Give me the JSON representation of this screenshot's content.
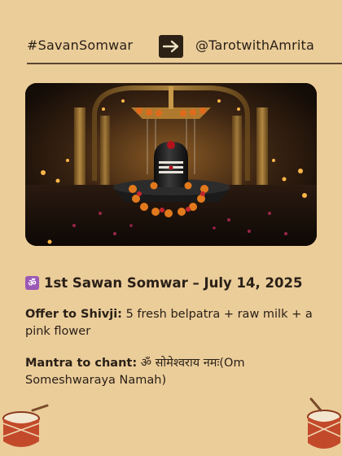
{
  "header": {
    "hashtag": "#SavanSomwar",
    "handle": "@TarotwithAmrita",
    "arrow_icon": "right-arrow-icon"
  },
  "photo": {
    "description_icon": "shivling-icon"
  },
  "content": {
    "heading_icon": "om-icon",
    "heading_icon_glyph": "ॐ",
    "heading": "1st Sawan Somwar – July 14, 2025",
    "offer_label": "Offer to Shivji:",
    "offer_text": " 5 fresh belpatra + raw milk + a pink flower",
    "mantra_label": "Mantra to chant:",
    "mantra_text": " ॐ सोमेश्वराय नमः(Om Someshwaraya Namah)"
  },
  "colors": {
    "background": "#ebcd9a",
    "text": "#2a2017",
    "accent_badge": "#9b59b6"
  }
}
